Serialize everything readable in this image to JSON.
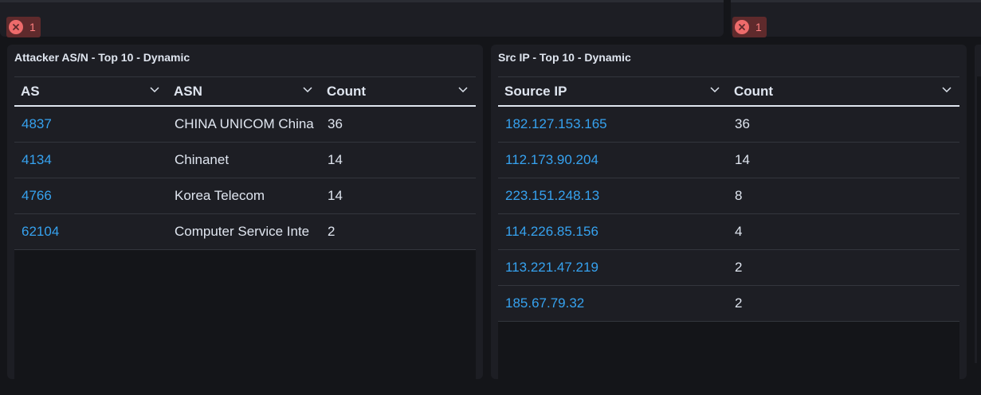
{
  "errors": [
    {
      "count": "1"
    },
    {
      "count": "1"
    }
  ],
  "panel_as": {
    "title": "Attacker AS/N - Top 10 - Dynamic",
    "columns": [
      "AS",
      "ASN",
      "Count"
    ],
    "rows": [
      {
        "as": "4837",
        "asn": "CHINA UNICOM China",
        "count": "36"
      },
      {
        "as": "4134",
        "asn": "Chinanet",
        "count": "14"
      },
      {
        "as": "4766",
        "asn": "Korea Telecom",
        "count": "14"
      },
      {
        "as": "62104",
        "asn": "Computer Service Inte",
        "count": "2"
      }
    ]
  },
  "panel_ip": {
    "title": "Src IP - Top 10 - Dynamic",
    "columns": [
      "Source IP",
      "Count"
    ],
    "rows": [
      {
        "ip": "182.127.153.165",
        "count": "36"
      },
      {
        "ip": "112.173.90.204",
        "count": "14"
      },
      {
        "ip": "223.151.248.13",
        "count": "8"
      },
      {
        "ip": "114.226.85.156",
        "count": "4"
      },
      {
        "ip": "113.221.47.219",
        "count": "2"
      },
      {
        "ip": "185.67.79.32",
        "count": "2"
      }
    ]
  },
  "colors": {
    "link": "#36a2ef",
    "error": "#ee6b6b",
    "background": "#141519",
    "panel": "#1d1e24"
  }
}
